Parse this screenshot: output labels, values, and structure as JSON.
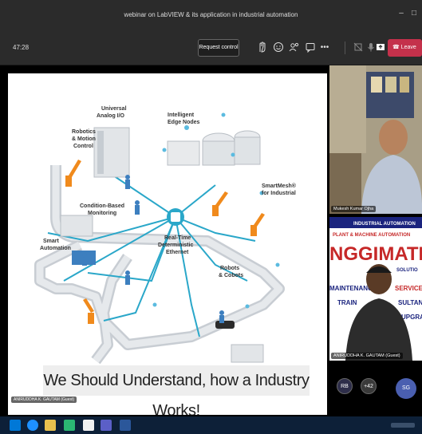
{
  "window": {
    "title": "webinar on LabVIEW & its application in industrial automation",
    "min_glyph": "–",
    "max_glyph": "□"
  },
  "toolbar": {
    "timer": "47:28",
    "request_control_label": "Request control",
    "leave_label": "Leave",
    "more_glyph": "•••"
  },
  "slide": {
    "caption": "We Should Understand, how a Industry Works!",
    "labels": {
      "universal_io": [
        "Universal",
        "Analog I/O"
      ],
      "edge_nodes": [
        "Intelligent",
        "Edge Nodes"
      ],
      "robotics": [
        "Robotics",
        "& Motion",
        "Control"
      ],
      "smartmesh": [
        "SmartMesh®",
        "for Industrial"
      ],
      "condition": [
        "Condition-Based",
        "Monitoring"
      ],
      "smart_automation": [
        "Smart",
        "Automation"
      ],
      "ethernet": [
        "Real-Time",
        "Deterministic",
        "Ethernet"
      ],
      "robots": [
        "Robots",
        "& Cobots"
      ]
    },
    "presenter_label": "ANIRUDDHA K. GAUTAM (Guest)"
  },
  "participants": [
    {
      "name": "Mukesh Kumar Ojha"
    },
    {
      "name": "ANIRUDDHA K. GAUTAM (Guest)",
      "banner_lines": [
        "INDUSTRIAL AUTOMATION",
        "PLANT & MACHINE AUTOMATION",
        "NGGIMATIX",
        "SOLUTIO",
        "MAINTENANC",
        "SERVICE",
        "TRAIN",
        "SULTANC",
        "UPGRA"
      ]
    }
  ],
  "avatars": [
    {
      "initials": "RB",
      "color": "#2e2e4a"
    },
    {
      "initials": "+42",
      "color": "#3a3a3a"
    },
    {
      "initials": "SG",
      "color": "#4a5fb0"
    }
  ],
  "colors": {
    "accent_red": "#c4314b",
    "conveyor": "#c8cdd3",
    "network_line": "#2aa7c9",
    "robot_orange": "#f08a1c"
  }
}
